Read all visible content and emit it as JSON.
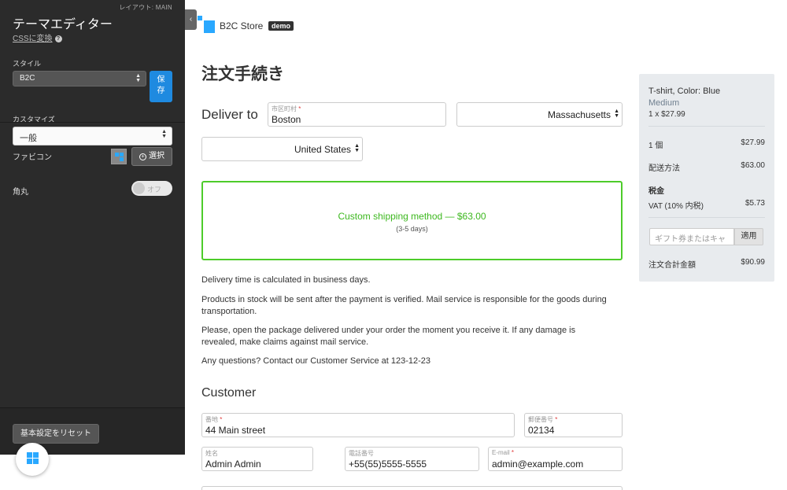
{
  "editor": {
    "layout_tag": "レイアウト: MAIN",
    "title": "テーマエディター",
    "css_link": "CSSに変換",
    "style_label": "スタイル",
    "style_value": "B2C",
    "save_label": "保存",
    "customize_label": "カスタマイズ",
    "customize_value": "一般",
    "favicon_label": "ファビコン",
    "choose_label": "選択",
    "rounded_label": "角丸",
    "rounded_toggle": "オフ",
    "reset_label": "基本設定をリセット"
  },
  "store": {
    "name": "B2C Store",
    "badge": "demo"
  },
  "checkout": {
    "title": "注文手続き",
    "deliver_to": "Deliver to",
    "city_label": "市区町村",
    "city_value": "Boston",
    "state_value": "Massachusetts",
    "country_value": "United States",
    "shipping_name": "Custom shipping method — $63.00",
    "shipping_days": "(3-5 days)",
    "info": [
      "Delivery time is calculated in business days.",
      "Products in stock will be sent after the payment is verified. Mail service is responsible for the goods during transportation.",
      "Please, open the package delivered under your order the moment you receive it. If any damage is revealed, make claims against mail service.",
      "Any questions? Contact our Customer Service at 123-12-23"
    ],
    "customer_title": "Customer",
    "address_label": "番地",
    "address_value": "44 Main street",
    "zip_label": "郵便番号",
    "zip_value": "02134",
    "name_label": "姓名",
    "name_value": "Admin Admin",
    "phone_label": "電話番号",
    "phone_value": "+55(55)5555-5555",
    "email_label": "E-mail",
    "email_value": "admin@example.com"
  },
  "summary": {
    "product_name": "T-shirt, Color: Blue",
    "product_variant": "Medium",
    "product_qty_price": "1 x $27.99",
    "items_label": "1 個",
    "items_value": "$27.99",
    "shipping_label": "配送方法",
    "shipping_value": "$63.00",
    "tax_title": "税金",
    "vat_label": "VAT (10% 内税)",
    "vat_value": "$5.73",
    "gift_placeholder": "ギフト券またはキャ",
    "apply_label": "適用",
    "total_label": "注文合計金額",
    "total_value": "$90.99"
  },
  "colors": {
    "accent": "#1f8ae0",
    "brand": "#29a8ff",
    "success": "#4dcc2a",
    "required": "#e03a3a"
  }
}
